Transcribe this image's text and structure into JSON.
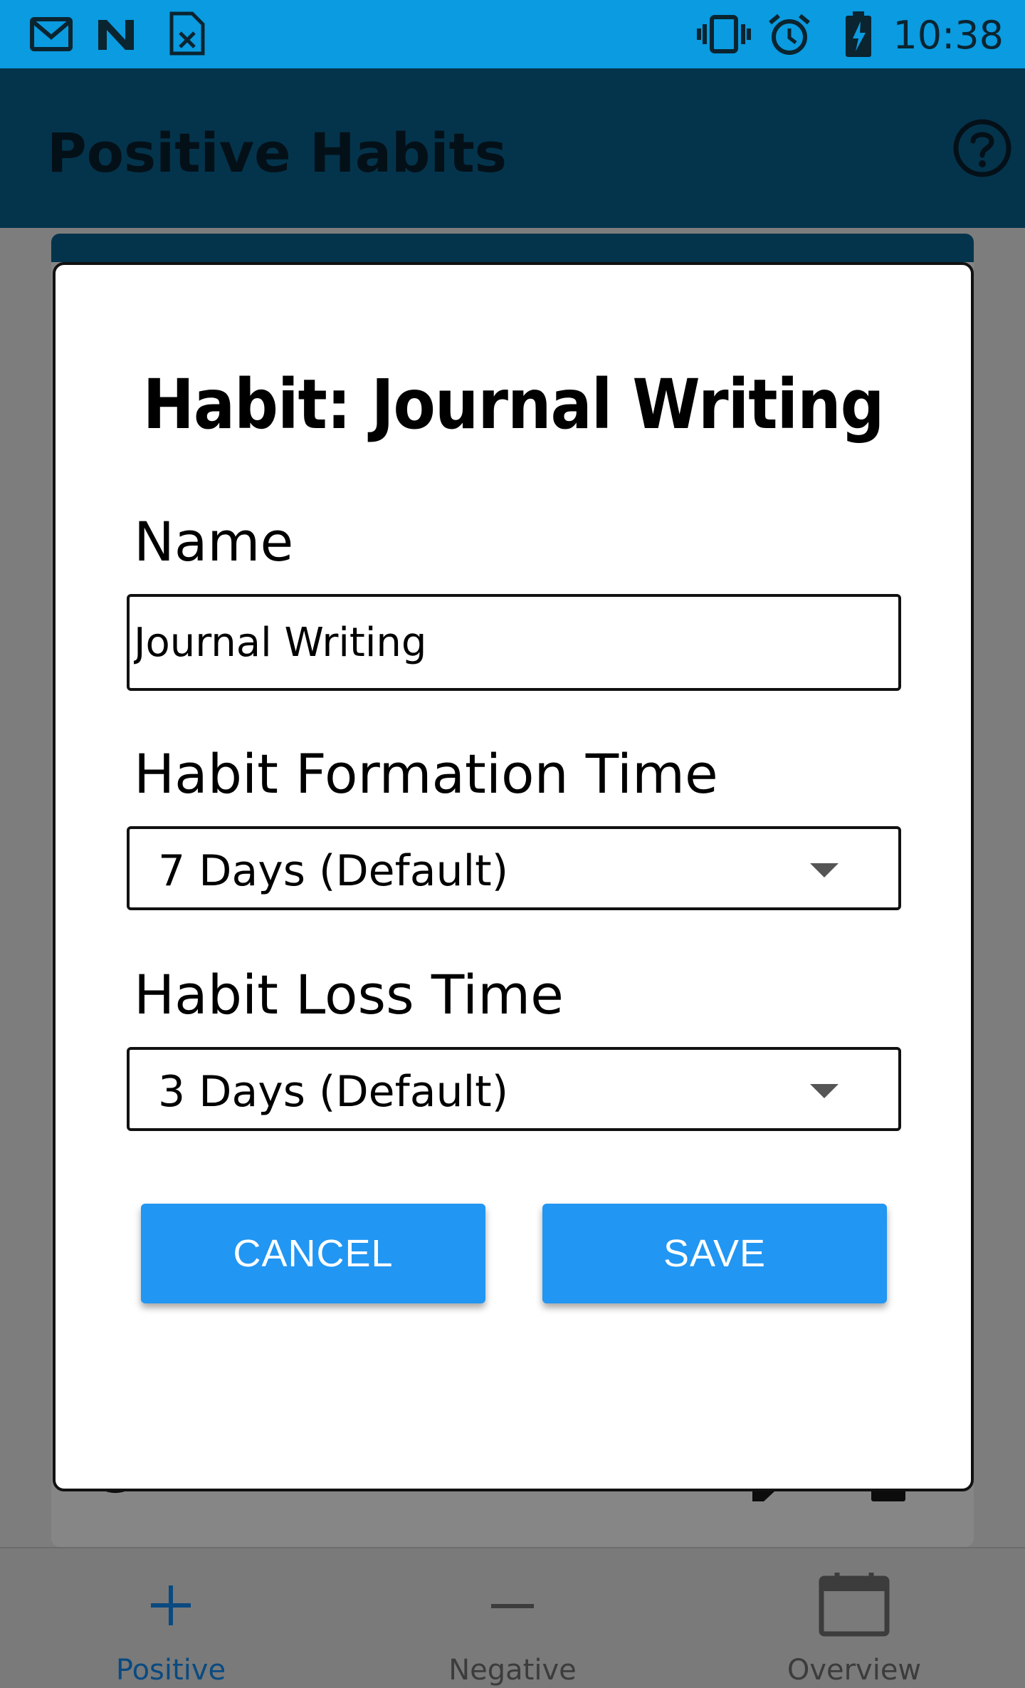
{
  "status_bar": {
    "time": "10:38",
    "icons": [
      "gmail-icon",
      "n-app-icon",
      "sheet-file-icon",
      "vibrate-icon",
      "alarm-icon",
      "battery-charging-icon"
    ]
  },
  "app_bar": {
    "title": "Positive Habits",
    "help_icon": "help-circle-icon"
  },
  "dialog": {
    "title": "Habit: Journal Writing",
    "name_label": "Name",
    "name_value": "Journal Writing",
    "formation_label": "Habit Formation Time",
    "formation_value": "7 Days (Default)",
    "loss_label": "Habit Loss Time",
    "loss_value": "3 Days (Default)",
    "cancel_label": "CANCEL",
    "save_label": "SAVE"
  },
  "bottom_nav": {
    "items": [
      {
        "label": "Positive",
        "icon": "plus-icon",
        "active": true
      },
      {
        "label": "Negative",
        "icon": "minus-icon",
        "active": false
      },
      {
        "label": "Overview",
        "icon": "calendar-icon",
        "active": false
      }
    ]
  },
  "colors": {
    "status_bar": "#0a9be0",
    "app_bar": "#04344c",
    "accent": "#2196f3",
    "nav_active": "#0a4a80"
  }
}
